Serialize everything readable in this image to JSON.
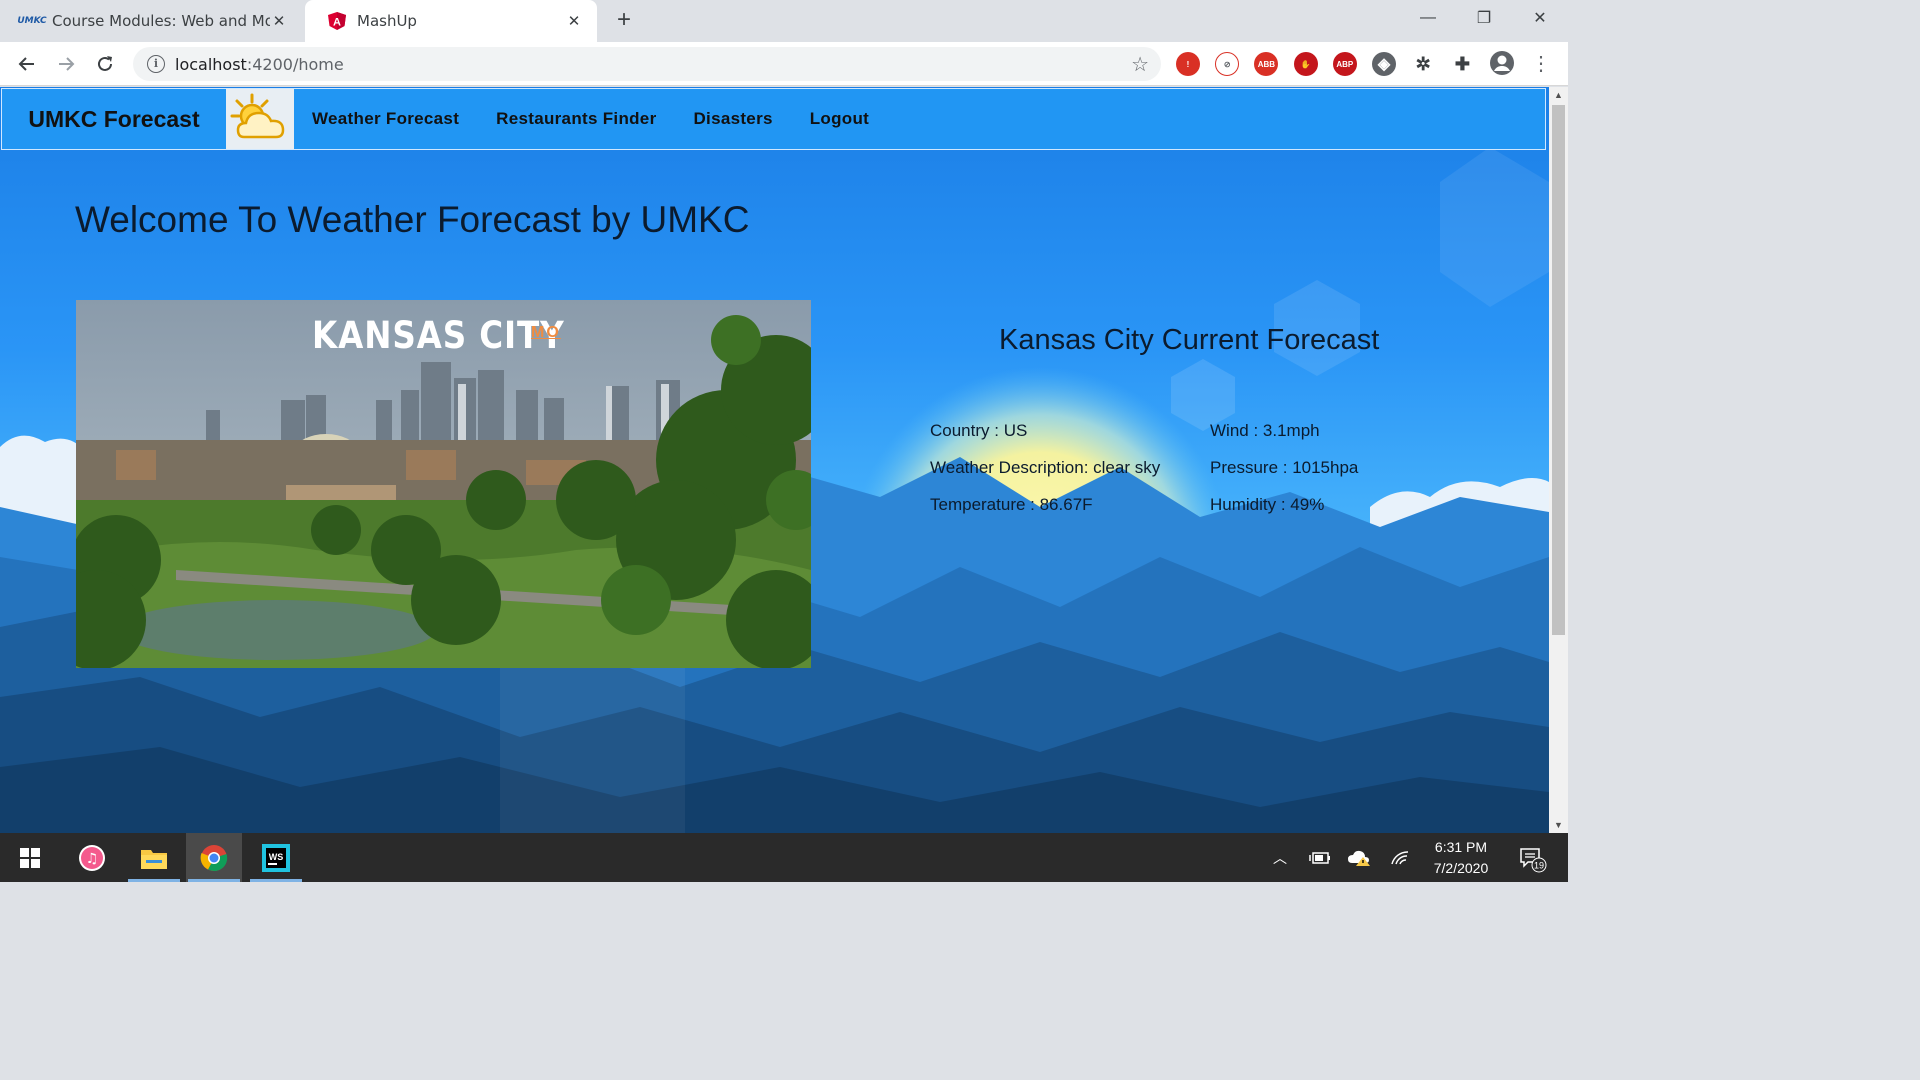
{
  "browser": {
    "tabs": [
      {
        "title": "Course Modules: Web and Mobil",
        "favicon": "umkc-favicon",
        "favicon_text": "UMKC",
        "active": false
      },
      {
        "title": "MashUp",
        "favicon": "angular-favicon",
        "active": true
      }
    ],
    "new_tab_symbol": "+",
    "close_symbol": "✕",
    "window_controls": {
      "minimize": "—",
      "restore": "❐",
      "close": "✕"
    },
    "address": {
      "host": "localhost",
      "rest": ":4200/home"
    },
    "extensions": [
      {
        "name": "extension-1-icon",
        "color": "#d93025",
        "label": "!"
      },
      {
        "name": "extension-2-icon",
        "color": "#ffffff",
        "label": "⊘"
      },
      {
        "name": "adblock-icon",
        "color": "#d93025",
        "label": "ABB"
      },
      {
        "name": "ublock-icon",
        "color": "#c4161c",
        "label": "✋"
      },
      {
        "name": "abp-icon",
        "color": "#c4161c",
        "label": "ABP"
      },
      {
        "name": "shield-icon",
        "color": "#5f6368",
        "label": "◈"
      },
      {
        "name": "bug-icon",
        "color": "#ffffff",
        "label": "✲"
      },
      {
        "name": "puzzle-icon",
        "color": "#ffffff",
        "label": "✚"
      }
    ]
  },
  "navbar": {
    "brand": "UMKC Forecast",
    "links": [
      "Weather Forecast",
      "Restaurants Finder",
      "Disasters",
      "Logout"
    ],
    "accent": "#2196f3"
  },
  "page": {
    "welcome": "Welcome To Weather Forecast by UMKC",
    "photo": {
      "city": "KANSAS CITY",
      "state": "MO"
    },
    "forecast": {
      "title": "Kansas City Current Forecast",
      "country": "Country : US",
      "description": "Weather Description: clear sky",
      "temperature": "Temperature : 86.67F",
      "wind": "Wind : 3.1mph",
      "pressure": "Pressure : 1015hpa",
      "humidity": "Humidity : 49%"
    }
  },
  "taskbar": {
    "apps": [
      "start-icon",
      "itunes-icon",
      "file-explorer-icon",
      "chrome-icon",
      "webstorm-icon"
    ],
    "webstorm_label": "WS",
    "time": "6:31 PM",
    "date": "7/2/2020",
    "notifications": "19"
  }
}
